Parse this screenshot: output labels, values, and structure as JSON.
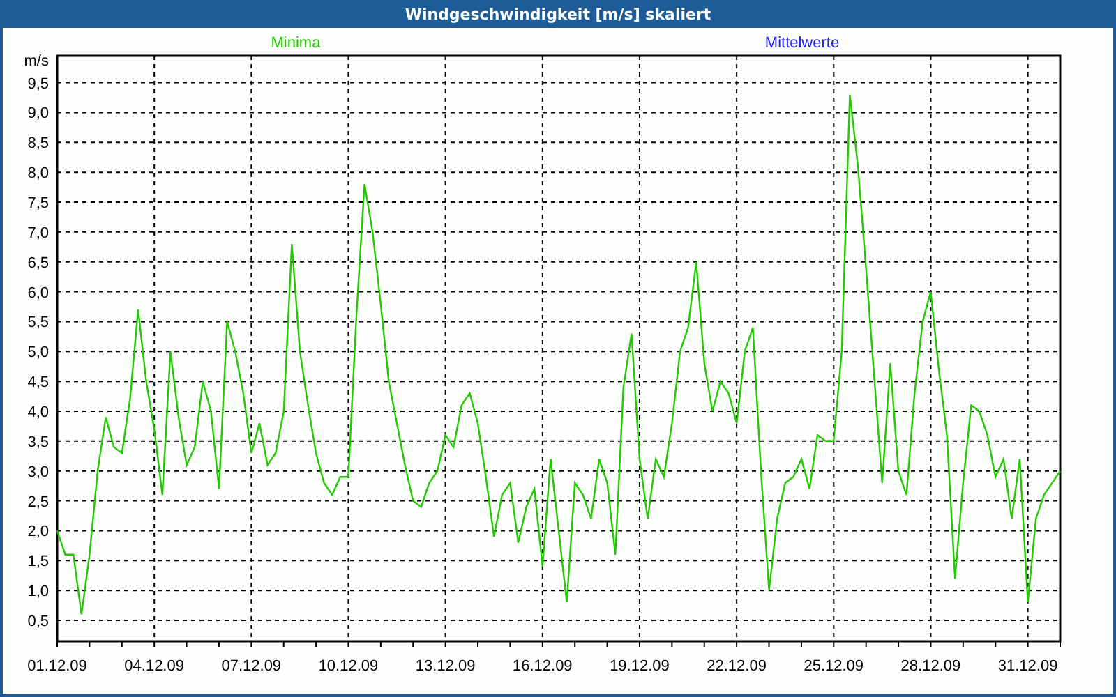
{
  "window": {
    "title": "Windgeschwindigkeit [m/s] skaliert"
  },
  "chart": {
    "chart_data": {
      "type": "line",
      "grid": true,
      "ylabel": "m/s",
      "ylim": [
        0.15,
        9.95
      ],
      "yticks": [
        {
          "value": 0.5,
          "label": "0,5"
        },
        {
          "value": 1,
          "label": "1,0"
        },
        {
          "value": 1.5,
          "label": "1,5"
        },
        {
          "value": 2,
          "label": "2,0"
        },
        {
          "value": 2.5,
          "label": "2,5"
        },
        {
          "value": 3,
          "label": "3,0"
        },
        {
          "value": 3.5,
          "label": "3,5"
        },
        {
          "value": 4,
          "label": "4,0"
        },
        {
          "value": 4.5,
          "label": "4,5"
        },
        {
          "value": 5,
          "label": "5,0"
        },
        {
          "value": 5.5,
          "label": "5,5"
        },
        {
          "value": 6,
          "label": "6,0"
        },
        {
          "value": 6.5,
          "label": "6,5"
        },
        {
          "value": 7,
          "label": "7,0"
        },
        {
          "value": 7.5,
          "label": "7,5"
        },
        {
          "value": 8,
          "label": "8,0"
        },
        {
          "value": 8.5,
          "label": "8,5"
        },
        {
          "value": 9,
          "label": "9,0"
        },
        {
          "value": 9.5,
          "label": "9,5"
        }
      ],
      "categories": [
        "01.12.09",
        null,
        null,
        null,
        null,
        null,
        null,
        null,
        null,
        null,
        null,
        null,
        "04.12.09",
        null,
        null,
        null,
        null,
        null,
        null,
        null,
        null,
        null,
        null,
        null,
        "07.12.09",
        null,
        null,
        null,
        null,
        null,
        null,
        null,
        null,
        null,
        null,
        null,
        "10.12.09",
        null,
        null,
        null,
        null,
        null,
        null,
        null,
        null,
        null,
        null,
        null,
        "13.12.09",
        null,
        null,
        null,
        null,
        null,
        null,
        null,
        null,
        null,
        null,
        null,
        "16.12.09",
        null,
        null,
        null,
        null,
        null,
        null,
        null,
        null,
        null,
        null,
        null,
        "19.12.09",
        null,
        null,
        null,
        null,
        null,
        null,
        null,
        null,
        null,
        null,
        null,
        "22.12.09",
        null,
        null,
        null,
        null,
        null,
        null,
        null,
        null,
        null,
        null,
        null,
        "25.12.09",
        null,
        null,
        null,
        null,
        null,
        null,
        null,
        null,
        null,
        null,
        null,
        "28.12.09",
        null,
        null,
        null,
        null,
        null,
        null,
        null,
        null,
        null,
        null,
        null,
        "31.12.09",
        null,
        null,
        null,
        null
      ],
      "series": [
        {
          "name": "Minima",
          "color": "#22c800",
          "values": [
            2.0,
            1.6,
            1.6,
            0.6,
            1.6,
            3.0,
            3.9,
            3.4,
            3.3,
            4.2,
            5.7,
            4.5,
            3.7,
            2.6,
            5.0,
            3.9,
            3.1,
            3.4,
            4.5,
            4.0,
            2.7,
            5.5,
            5.0,
            4.3,
            3.3,
            3.8,
            3.1,
            3.3,
            4.0,
            6.8,
            5.0,
            4.1,
            3.3,
            2.8,
            2.6,
            2.9,
            2.9,
            5.6,
            7.8,
            7.0,
            5.8,
            4.5,
            3.8,
            3.1,
            2.5,
            2.4,
            2.8,
            3.0,
            3.6,
            3.4,
            4.1,
            4.3,
            3.8,
            2.9,
            1.9,
            2.6,
            2.8,
            1.8,
            2.4,
            2.7,
            1.4,
            3.2,
            2.0,
            0.8,
            2.8,
            2.6,
            2.2,
            3.2,
            2.8,
            1.6,
            4.4,
            5.3,
            3.2,
            2.2,
            3.2,
            2.9,
            3.8,
            5.0,
            5.4,
            6.5,
            4.8,
            4.0,
            4.5,
            4.3,
            3.8,
            5.0,
            5.4,
            3.0,
            1.0,
            2.2,
            2.8,
            2.9,
            3.2,
            2.7,
            3.6,
            3.5,
            3.5,
            5.0,
            9.3,
            8.1,
            6.4,
            4.6,
            2.8,
            4.8,
            3.0,
            2.6,
            4.3,
            5.5,
            6.0,
            4.7,
            3.6,
            1.2,
            2.8,
            4.1,
            4.0,
            3.6,
            2.9,
            3.2,
            2.2,
            3.2,
            0.8,
            2.2,
            2.6,
            2.8,
            3.0
          ]
        },
        {
          "name": "Mittelwerte",
          "color": "#2020ff",
          "values": [
            null,
            null,
            null,
            null,
            null,
            null,
            null,
            null,
            null,
            null,
            null,
            null,
            null,
            null,
            null,
            null,
            null,
            null,
            null,
            null,
            null,
            null,
            null,
            null,
            null,
            null,
            null,
            null,
            null,
            null,
            null,
            null,
            null,
            null,
            null,
            null,
            null,
            null,
            null,
            null,
            null,
            null,
            null,
            null,
            null,
            null,
            null,
            null,
            null,
            null,
            null,
            null,
            null,
            null,
            null,
            null,
            null,
            null,
            null,
            null,
            null,
            null,
            null,
            null,
            null,
            null,
            null,
            null,
            null,
            null,
            null,
            null,
            null,
            null,
            null,
            null,
            null,
            null,
            null,
            null,
            null,
            null,
            null,
            null,
            null,
            null,
            null,
            null,
            null,
            null,
            null,
            null,
            null,
            null,
            null,
            null,
            null,
            null,
            null,
            null,
            null,
            null,
            null,
            null,
            null,
            null,
            null,
            null,
            null,
            null,
            null,
            null,
            null,
            null,
            null,
            null,
            null,
            null,
            null,
            null,
            null,
            null,
            null,
            null,
            null
          ]
        }
      ]
    }
  }
}
